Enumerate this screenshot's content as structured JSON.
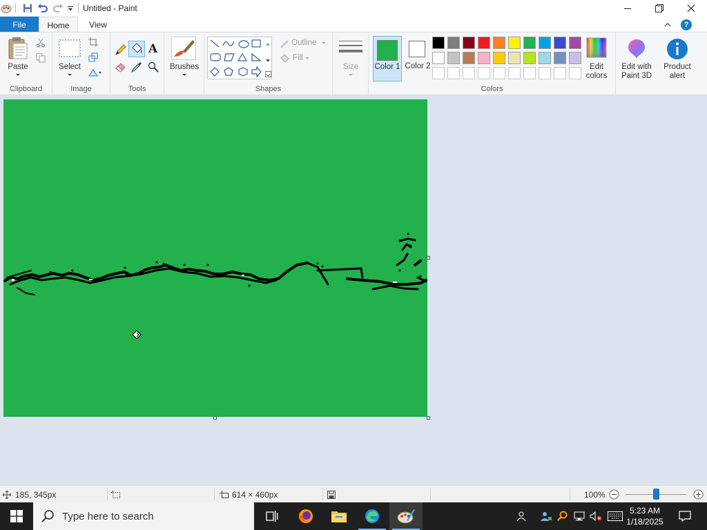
{
  "window": {
    "title": "Untitled - Paint"
  },
  "tabs": {
    "file": "File",
    "home": "Home",
    "view": "View"
  },
  "ribbon": {
    "clipboard": {
      "paste": "Paste",
      "group": "Clipboard"
    },
    "image": {
      "select": "Select",
      "group": "Image"
    },
    "tools": {
      "group": "Tools"
    },
    "brushes": {
      "label": "Brushes"
    },
    "shapes": {
      "outline": "Outline",
      "fill": "Fill",
      "group": "Shapes"
    },
    "size": {
      "label": "Size"
    },
    "colors": {
      "color1": "Color 1",
      "color2": "Color 2",
      "group": "Colors",
      "edit_colors": "Edit colors",
      "color1_value": "#22b14c",
      "color2_value": "#ffffff",
      "palette_row1": [
        "#000000",
        "#7f7f7f",
        "#880015",
        "#ed1c24",
        "#ff7f27",
        "#fff200",
        "#22b14c",
        "#00a2e8",
        "#3f48cc",
        "#a349a4"
      ],
      "palette_row2": [
        "#ffffff",
        "#c3c3c3",
        "#b97a57",
        "#ffaec9",
        "#ffc90e",
        "#efe4b0",
        "#b5e61d",
        "#99d9ea",
        "#7092be",
        "#c8bfe7"
      ]
    },
    "paint3d": {
      "label": "Edit with Paint 3D"
    },
    "product_alert": {
      "label": "Product alert"
    }
  },
  "canvas": {
    "background": "#22b14c"
  },
  "statusbar": {
    "cursor_pos": "185, 345px",
    "canvas_size": "614 × 460px",
    "zoom": "100%"
  },
  "taskbar": {
    "search_placeholder": "Type here to search",
    "time": "5:23 AM",
    "date": "1/18/2025"
  }
}
